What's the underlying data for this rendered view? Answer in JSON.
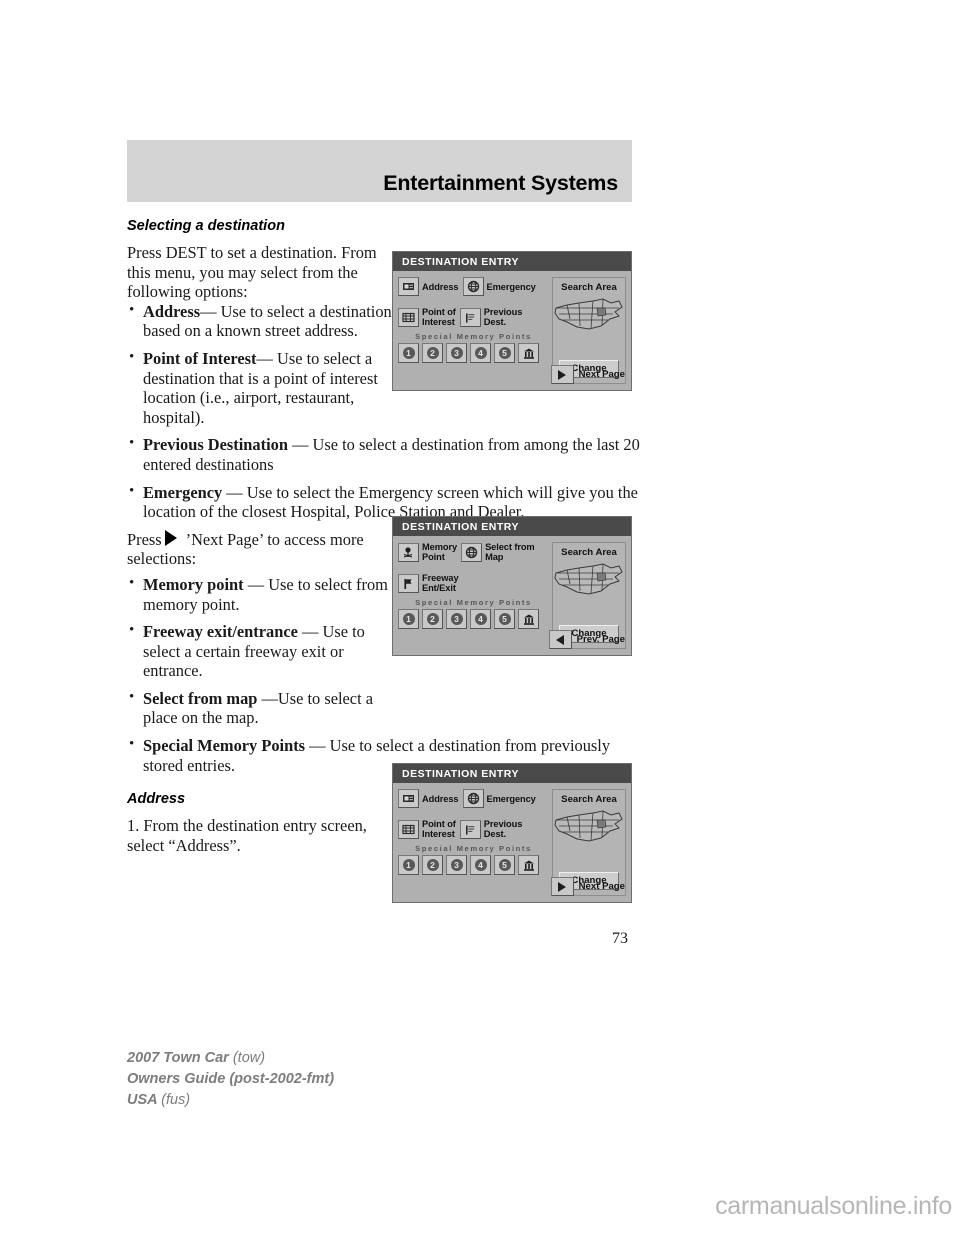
{
  "header": {
    "title": "Entertainment Systems"
  },
  "sections": {
    "selecting": {
      "heading": "Selecting a destination",
      "intro": "Press DEST to set a destination. From this menu, you may select from the following options:",
      "bullets": [
        {
          "term": "Address",
          "rest": "— Use to select a destination based on a known street address."
        },
        {
          "term": "Point of Interest",
          "rest": "— Use to select a destination that is a point of interest location (i.e., airport, restaurant, hospital)."
        },
        {
          "term": "Previous Destination",
          "rest": " — Use to select a destination from among the last 20 entered destinations"
        },
        {
          "term": "Emergency",
          "rest": " — Use to select the Emergency screen which will give you the location of the closest Hospital, Police Station and Dealer."
        }
      ],
      "press_prefix": "Press",
      "press_suffix": "’Next Page’ to access more selections:",
      "bullets2": [
        {
          "term": "Memory point",
          "rest": " — Use to select from a memory point."
        },
        {
          "term": "Freeway exit/entrance",
          "rest": " — Use to select a certain freeway exit or entrance."
        },
        {
          "term": "Select from map",
          "rest": " —Use to select a place on the map."
        },
        {
          "term": "Special Memory Points",
          "rest": " — Use to select a destination from previously stored entries."
        }
      ]
    },
    "address": {
      "heading": "Address",
      "step1": "1. From the destination entry screen, select “Address”."
    }
  },
  "nav_screens": [
    {
      "title": "DESTINATION ENTRY",
      "menu": [
        {
          "label": "Address",
          "icon": "address-card-icon"
        },
        {
          "label": "Emergency",
          "icon": "globe-icon"
        },
        {
          "label": "Point of\nInterest",
          "icon": "poi-icon"
        },
        {
          "label": "Previous\nDest.",
          "icon": "list-flag-icon"
        }
      ],
      "special_memory_points_label": "Special Memory Points",
      "memory_buttons": [
        "1",
        "2",
        "3",
        "4",
        "5"
      ],
      "bank_icon": "bank-building-icon",
      "search_area_label": "Search Area",
      "change_label": "Change",
      "page_nav_label": "Next Page",
      "page_nav_direction": "next"
    },
    {
      "title": "DESTINATION ENTRY",
      "menu": [
        {
          "label": "Memory\nPoint",
          "icon": "memory-point-icon"
        },
        {
          "label": "Select from\nMap",
          "icon": "globe-icon"
        },
        {
          "label": "Freeway\nEnt/Exit",
          "icon": "freeway-flag-icon"
        }
      ],
      "special_memory_points_label": "Special Memory Points",
      "memory_buttons": [
        "1",
        "2",
        "3",
        "4",
        "5"
      ],
      "bank_icon": "bank-building-icon",
      "search_area_label": "Search Area",
      "change_label": "Change",
      "page_nav_label": "Prev. Page",
      "page_nav_direction": "prev"
    },
    {
      "title": "DESTINATION ENTRY",
      "menu": [
        {
          "label": "Address",
          "icon": "address-card-icon"
        },
        {
          "label": "Emergency",
          "icon": "globe-icon"
        },
        {
          "label": "Point of\nInterest",
          "icon": "poi-icon"
        },
        {
          "label": "Previous\nDest.",
          "icon": "list-flag-icon"
        }
      ],
      "special_memory_points_label": "Special Memory Points",
      "memory_buttons": [
        "1",
        "2",
        "3",
        "4",
        "5"
      ],
      "bank_icon": "bank-building-icon",
      "search_area_label": "Search Area",
      "change_label": "Change",
      "page_nav_label": "Next Page",
      "page_nav_direction": "next"
    }
  ],
  "page_number": "73",
  "footer": {
    "line1_bold": "2007 Town Car",
    "line1_light": "(tow)",
    "line2_bold": "Owners Guide (post-2002-fmt)",
    "line3_bold": "USA",
    "line3_light": "(fus)"
  },
  "watermark": "carmanualsonline.info"
}
